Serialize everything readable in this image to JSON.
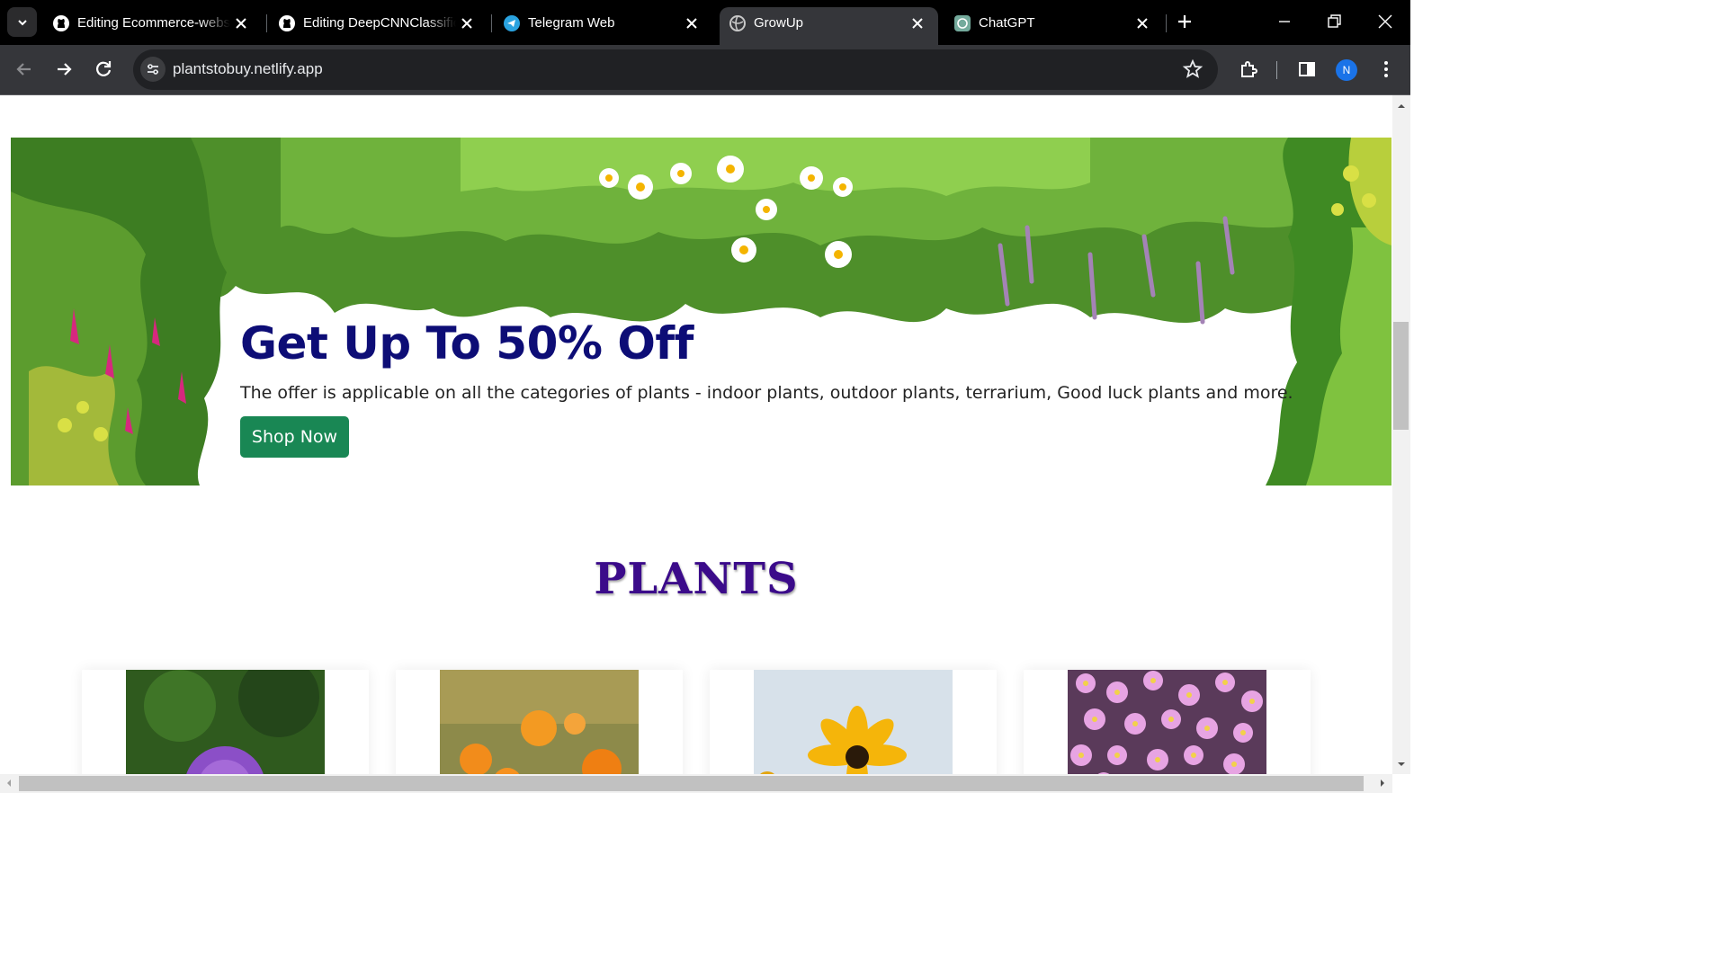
{
  "browser": {
    "tabs": [
      {
        "title": "Editing Ecommerce-webs",
        "icon": "github-icon"
      },
      {
        "title": "Editing DeepCNNClassific",
        "icon": "github-icon"
      },
      {
        "title": "Telegram Web",
        "icon": "telegram-icon"
      },
      {
        "title": "GrowUp",
        "icon": "globe-icon",
        "active": true
      },
      {
        "title": "ChatGPT",
        "icon": "chatgpt-icon"
      }
    ],
    "url": "plantstobuy.netlify.app",
    "profile_initial": "N"
  },
  "hero": {
    "title": "Get Up To 50% Off",
    "description": "The offer is applicable on all the categories of plants - indoor plants, outdoor plants, terrarium, Good luck plants and more.",
    "button_label": "Shop Now"
  },
  "plants_section": {
    "title": "PLANTS",
    "cards": [
      {
        "image": "purple-allium-flower"
      },
      {
        "image": "orange-calendula-flowers"
      },
      {
        "image": "yellow-black-eyed-susan"
      },
      {
        "image": "pink-aster-flowers"
      }
    ]
  },
  "colors": {
    "hero_title": "#0d0d76",
    "shop_button": "#198754",
    "section_title": "#3b0b8a",
    "chrome_dark": "#35363a"
  }
}
